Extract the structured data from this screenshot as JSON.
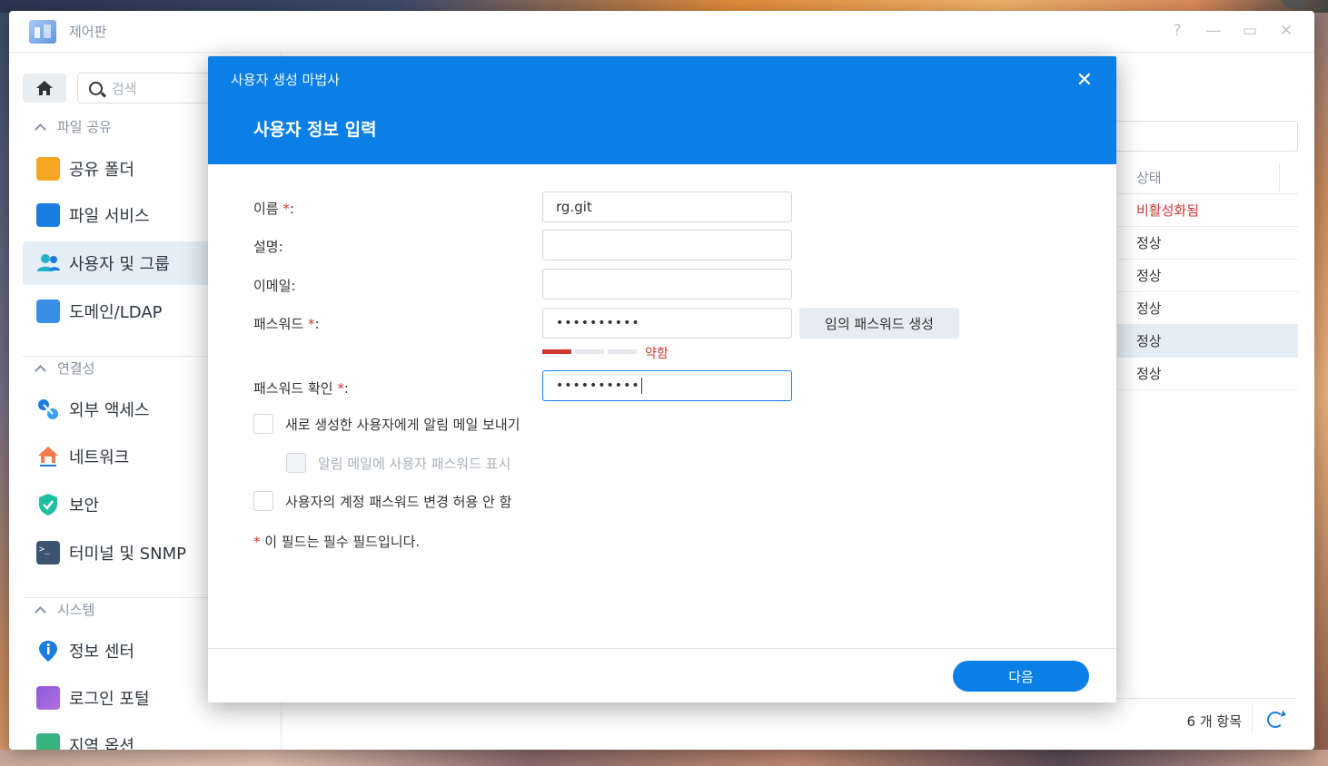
{
  "window": {
    "title": "제어판"
  },
  "sidebar": {
    "search_placeholder": "검색",
    "sections": {
      "file_sharing": "파일 공유",
      "connectivity": "연결성",
      "system": "시스템"
    },
    "items": {
      "shared_folder": "공유 폴더",
      "file_services": "파일 서비스",
      "user_group": "사용자 및 그룹",
      "domain_ldap": "도메인/LDAP",
      "external_access": "외부 액세스",
      "network": "네트워크",
      "security": "보안",
      "terminal_snmp": "터미널 및 SNMP",
      "info_center": "정보 센터",
      "login_portal": "로그인 포털",
      "partial_item": "지역 옵션"
    }
  },
  "list": {
    "status_header": "상태",
    "rows": [
      "비활성화됨",
      "정상",
      "정상",
      "정상",
      "정상",
      "정상"
    ],
    "count": "6 개 항목"
  },
  "dialog": {
    "wizard_title": "사용자 생성 마법사",
    "step_title": "사용자 정보 입력",
    "labels": {
      "name": "이름",
      "description": "설명:",
      "email": "이메일:",
      "password": "패스워드",
      "confirm_password": "패스워드 확인",
      "required_suffix": "*",
      "colon": ":"
    },
    "values": {
      "name": "rg.git",
      "description": "",
      "email": "",
      "password": "••••••••••",
      "confirm_password": "••••••••••"
    },
    "generate_password_button": "임의 패스워드 생성",
    "strength_label": "약함",
    "options": {
      "send_mail": "새로 생성한 사용자에게 알림 메일 보내기",
      "show_password_in_mail": "알림 메일에 사용자 패스워드 표시",
      "disallow_change": "사용자의 계정 패스워드 변경 허용 안 함"
    },
    "required_note": "이 필드는 필수 필드입니다.",
    "next_button": "다음",
    "close_glyph": "✕"
  },
  "colors": {
    "accent": "#0a7fe6",
    "error": "#d0392f"
  }
}
